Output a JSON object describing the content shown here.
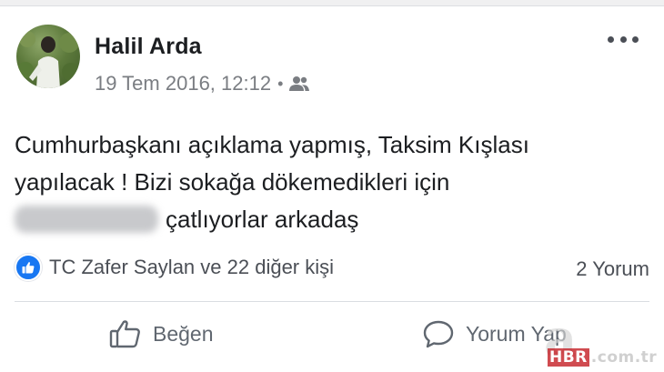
{
  "post": {
    "author": "Halil Arda",
    "timestamp": "19 Tem 2016, 12:12",
    "separator": "•",
    "audience_icon": "friends-icon",
    "more_icon": "more-options-icon",
    "text_line_1": "Cumhurbaşkanı açıklama yapmış, Taksim Kışlası",
    "text_line_2": "yapılacak ! Bizi sokağa dökemedikleri için",
    "text_line_3_after_redaction": "çatlıyorlar arkadaş"
  },
  "reactions": {
    "icon": "like-icon",
    "summary": "TC Zafer Saylan ve 22 diğer kişi",
    "comments_count": "2 Yorum"
  },
  "actions": {
    "like_label": "Beğen",
    "comment_label": "Yorum Yap"
  },
  "watermark": {
    "letter": "a",
    "brand": "HBR",
    "domain": ".com.tr"
  },
  "colors": {
    "like_blue": "#1877f2",
    "text_primary": "#1c1e21",
    "text_secondary": "#7a7d82"
  }
}
